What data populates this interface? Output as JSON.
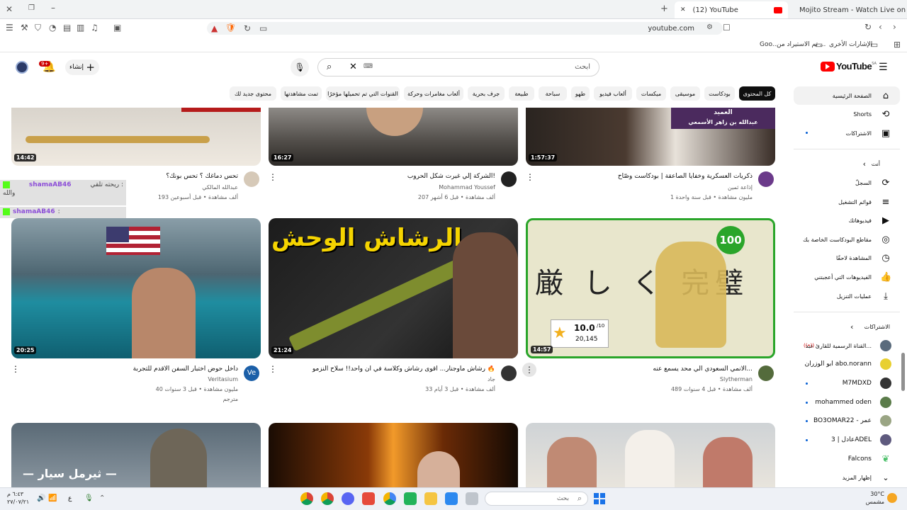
{
  "browser": {
    "tabs": [
      {
        "title": "(12) YouTube",
        "active": true
      },
      {
        "title": "Mojito Stream - Watch Live on Kick",
        "active": false
      }
    ],
    "url": "youtube.com",
    "bookmarks": {
      "folder1": "الإشارات الأخرى",
      "folder2": "تم الاستيراد من ...",
      "folder3": "Goo..."
    }
  },
  "youtube": {
    "logo": "YouTube",
    "logo_sup": "SA",
    "search_placeholder": "ابحث",
    "create_label": "إنشاء",
    "notif_count": "9+",
    "chips": [
      "كل المحتوى",
      "بودكاست",
      "موسيقى",
      "ميكسات",
      "ألعاب فيديو",
      "طهو",
      "سباحة",
      "طبيعة",
      "جرف بحرية",
      "ألعاب مغامرات وحركة",
      "القنوات التي تم تحميلها مؤخرًا",
      "تمت مشاهدتها",
      "محتوى جديد لك"
    ],
    "rows": [
      [
        {
          "title": "ذكريات العسكرية وخفايا الصاعقة | بودكاست وصّاح",
          "channel": "إذاعة ثمين",
          "meta": "1 مليون مشاهدة • قبل سنة واحدة",
          "duration": "1:57:37",
          "thumb_caption": "العميد",
          "thumb_caption2": "عبدالله بن زاهر الأسمعي"
        },
        {
          "title": "الشركة إلي غيرت شكل الحروب!",
          "channel": "Mohammad Youssef",
          "meta": "207 ألف مشاهدة • قبل 6 أشهر",
          "duration": "16:27"
        },
        {
          "title": "تحس دماغك ؟ تحس بونك؟",
          "channel": "عبدالله المالكي",
          "meta": "193 ألف مشاهدة • قبل أسبوعين",
          "duration": "14:42"
        }
      ],
      [
        {
          "title": "الانمي السعودي الي محد يسمع عنه...",
          "channel": "Slytherman",
          "meta": "489 ألف مشاهدة • قبل 4 سنوات",
          "duration": "14:57",
          "thumb_text": "厳 し く 完璧",
          "badge": "100",
          "rating": "10.0",
          "rating_max": "/10",
          "rating_count": "20,145"
        },
        {
          "title": "رشاش ماوجنار... أقوى رشاش وكلاسة في أن واحد!! سلاح النزمو 🔥",
          "channel": "جاد",
          "meta": "33 ألف مشاهدة • قبل 3 أيام",
          "duration": "21:24",
          "thumb_text": "الرشاش الوحش"
        },
        {
          "title": "داخل حوض اختبار السفن الأقدم للتجربة",
          "channel": "Veritasium",
          "meta": "40 مليون مشاهدة • قبل 3 سنوات",
          "duration": "20:25",
          "extra": "مترجم"
        }
      ],
      [
        {
          "title": "",
          "channel": "",
          "meta": "",
          "duration": ""
        },
        {
          "title": "",
          "channel": "",
          "meta": "",
          "duration": ""
        },
        {
          "title": "",
          "channel": "",
          "meta": "",
          "duration": "",
          "thumb_text": "— ثيرمل سيار —"
        }
      ]
    ],
    "sidebar": {
      "main": [
        {
          "label": "الصفحة الرئيسية",
          "icon": "home-icon"
        },
        {
          "label": "Shorts",
          "icon": "shorts-icon"
        },
        {
          "label": "الاشتراكات",
          "icon": "subscriptions-icon"
        }
      ],
      "you_header": "أنت",
      "you": [
        {
          "label": "السجلّ",
          "icon": "history-icon"
        },
        {
          "label": "قوائم التشغيل",
          "icon": "playlist-icon"
        },
        {
          "label": "فيديوهاتك",
          "icon": "your-videos-icon"
        },
        {
          "label": "مقاطع البودكاست الخاصة بك",
          "icon": "podcast-icon"
        },
        {
          "label": "المشاهدة لاحقًا",
          "icon": "watch-later-icon"
        },
        {
          "label": "الفيديوهات التي أعجبتني",
          "icon": "like-icon"
        },
        {
          "label": "عمليات التنزيل",
          "icon": "download-icon"
        }
      ],
      "subs_header": "الاشتراكات",
      "subs": [
        {
          "label": "القناة الرسمية للقارئ عبد...",
          "live": "((•))",
          "color": "#5a6b7c"
        },
        {
          "label": "ابو الوزران abo.norann",
          "color": "#e8d030"
        },
        {
          "label": "M7MDXD",
          "color": "#333"
        },
        {
          "label": "mohammed oden",
          "color": "#5b7c4a"
        },
        {
          "label": "BO3OMAR22 - عمر",
          "color": "#9aa584"
        },
        {
          "label": "عادل | 3ADEL",
          "color": "#5e5a7e"
        },
        {
          "label": "Falcons",
          "color": "#4cc06a"
        },
        {
          "label": "إظهار المزيد",
          "icon": "chevron-down-icon"
        }
      ]
    },
    "chat_overlay": [
      {
        "user": "shamaAB46",
        "text": "ريحته تلقي :",
        "line2": "والله"
      },
      {
        "user": "shamaAB46",
        "text": ":"
      }
    ]
  },
  "taskbar": {
    "time": "٦:٤٣ م",
    "date": "٢٧/٠٧/٢١",
    "lang": "ع",
    "search_placeholder": "بحث",
    "weather_temp": "30°C",
    "weather_desc": "مشمس"
  },
  "colors": {
    "yt_red": "#ff0000",
    "kick_green": "#53fc18",
    "chip_selected": "#0f0f0f"
  }
}
